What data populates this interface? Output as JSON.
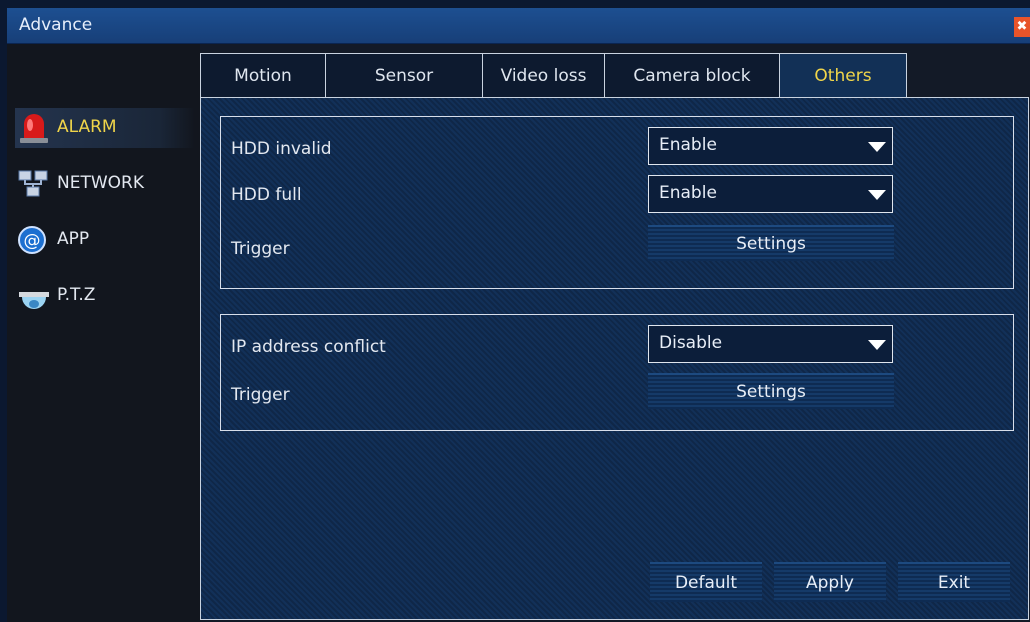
{
  "window": {
    "title": "Advance",
    "close_glyph": "✖"
  },
  "sidebar": {
    "items": [
      {
        "label": "ALARM",
        "icon": "alarm-siren-icon",
        "active": true
      },
      {
        "label": "NETWORK",
        "icon": "network-icon",
        "active": false
      },
      {
        "label": "APP",
        "icon": "at-sign-icon",
        "active": false
      },
      {
        "label": "P.T.Z",
        "icon": "dome-camera-icon",
        "active": false
      }
    ]
  },
  "tabs": [
    {
      "label": "Motion",
      "active": false
    },
    {
      "label": "Sensor",
      "active": false
    },
    {
      "label": "Video loss",
      "active": false
    },
    {
      "label": "Camera block",
      "active": false
    },
    {
      "label": "Others",
      "active": true
    }
  ],
  "group1": {
    "hdd_invalid": {
      "label": "HDD invalid",
      "value": "Enable"
    },
    "hdd_full": {
      "label": "HDD full",
      "value": "Enable"
    },
    "trigger": {
      "label": "Trigger",
      "button": "Settings"
    }
  },
  "group2": {
    "ip_conflict": {
      "label": "IP address conflict",
      "value": "Disable"
    },
    "trigger": {
      "label": "Trigger",
      "button": "Settings"
    }
  },
  "footer": {
    "default": "Default",
    "apply": "Apply",
    "exit": "Exit"
  },
  "colors": {
    "accent": "#f0d54a",
    "titlebar": "#1d4f91",
    "close": "#e8542a"
  }
}
